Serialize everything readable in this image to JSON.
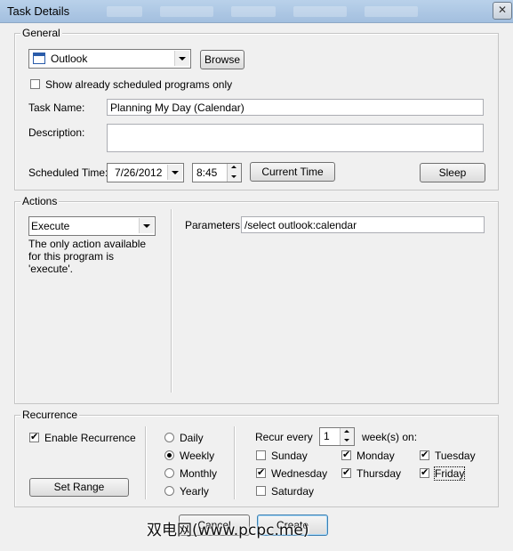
{
  "window": {
    "title": "Task Details",
    "close_glyph": "✕"
  },
  "general": {
    "legend": "General",
    "program": "Outlook",
    "browse_label": "Browse",
    "show_scheduled_label": "Show already scheduled programs only",
    "show_scheduled_checked": false,
    "task_name_label": "Task Name:",
    "task_name_value": "Planning My Day (Calendar)",
    "description_label": "Description:",
    "description_value": "",
    "scheduled_time_label": "Scheduled Time:",
    "date_value": "7/26/2012",
    "time_value": "8:45",
    "current_time_label": "Current Time",
    "sleep_label": "Sleep"
  },
  "actions": {
    "legend": "Actions",
    "action_value": "Execute",
    "note": "The only action available for this program is 'execute'.",
    "parameters_label": "Parameters:",
    "parameters_value": "/select outlook:calendar"
  },
  "recurrence": {
    "legend": "Recurrence",
    "enable_label": "Enable Recurrence",
    "enable_checked": true,
    "set_range_label": "Set Range",
    "frequency_options": [
      "Daily",
      "Weekly",
      "Monthly",
      "Yearly"
    ],
    "selected_frequency": "Weekly",
    "recur_every_label": "Recur every",
    "recur_every_value": "1",
    "weeks_on_label": "week(s) on:",
    "days": [
      {
        "label": "Sunday",
        "checked": false
      },
      {
        "label": "Monday",
        "checked": true
      },
      {
        "label": "Tuesday",
        "checked": true
      },
      {
        "label": "Wednesday",
        "checked": true
      },
      {
        "label": "Thursday",
        "checked": true
      },
      {
        "label": "Friday",
        "checked": true
      },
      {
        "label": "Saturday",
        "checked": false
      }
    ]
  },
  "footer": {
    "cancel_label": "Cancel",
    "create_label": "Create"
  },
  "watermark": "双电网(www.pcpc.me)"
}
